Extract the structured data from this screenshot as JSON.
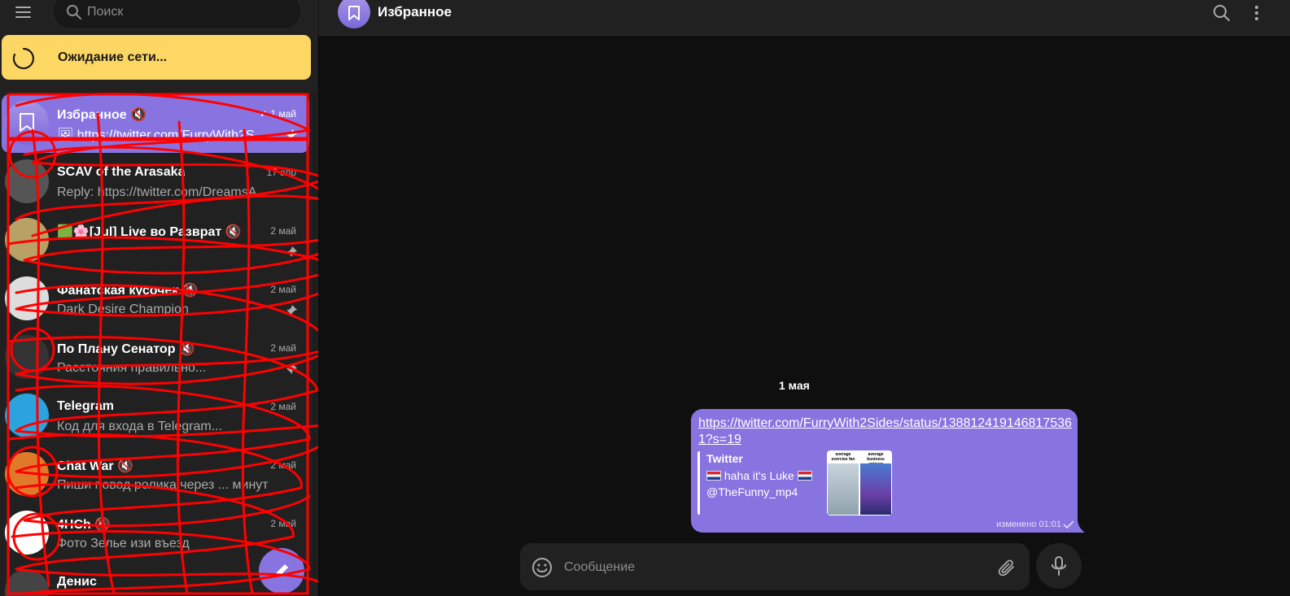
{
  "sidebar": {
    "search_placeholder": "Поиск",
    "network_status": "Ожидание сети...",
    "chats": [
      {
        "name": "Избранное 🔇",
        "time": "1 май",
        "preview": "🖼 https://twitter.com/FurryWith2S...",
        "pinned": true,
        "active": true
      },
      {
        "name": "SCAV of the Arasaka",
        "time": "17 апр",
        "preview": "Reply: https://twitter.com/DreamsA...",
        "pinned": false
      },
      {
        "name": "🟩🌸[Jul] Live во Разврат 🔇",
        "time": "2 май",
        "preview": "",
        "pinned": true
      },
      {
        "name": "Фанатская кусочек 🔇",
        "time": "2 май",
        "preview": "Dark Desire Champion",
        "pinned": true
      },
      {
        "name": "По Плану Сенатор 🔇",
        "time": "2 май",
        "preview": "Расстояния правильно...",
        "pinned": true
      },
      {
        "name": "Telegram",
        "time": "2 май",
        "preview": "Код для входа в Telegram...",
        "pinned": false
      },
      {
        "name": "Chat War 🔇",
        "time": "2 май",
        "preview": "Пиши повод ролика через ... минут",
        "pinned": false
      },
      {
        "name": "4HCh 🔇",
        "time": "2 май",
        "preview": "Фото Зелье изи въезд",
        "pinned": false
      },
      {
        "name": "Денис",
        "time": "",
        "preview": "",
        "pinned": false
      }
    ]
  },
  "header": {
    "title": "Избранное"
  },
  "messages": {
    "date_label": "1 мая",
    "items": [
      {
        "link_text": "https://twitter.com/FurryWith2Sides/status/1388124191468175361?s=19",
        "preview_site": "Twitter",
        "preview_title": "haha it's Luke",
        "preview_handle": "@TheFunny_mp4",
        "thumb_labels": [
          "average exercise fan",
          "average business enjoyer"
        ],
        "meta": "изменено 01:01"
      }
    ]
  },
  "composer": {
    "placeholder": "Сообщение"
  },
  "colors": {
    "accent": "#8774e1",
    "network_banner": "#fdd764",
    "background": "#0f0f0f",
    "panel": "#212121",
    "scribble": "#ff0000"
  }
}
